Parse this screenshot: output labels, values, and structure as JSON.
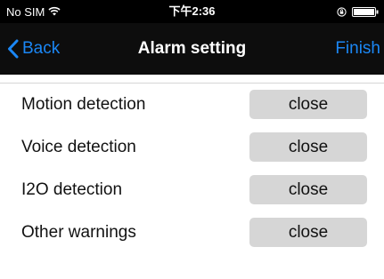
{
  "status_bar": {
    "carrier": "No SIM",
    "time": "下午2:36",
    "wifi_icon": "wifi-icon",
    "lock_icon": "rotation-lock-icon",
    "battery_icon": "battery-icon"
  },
  "nav": {
    "back_label": "Back",
    "title": "Alarm setting",
    "finish_label": "Finish"
  },
  "settings": [
    {
      "label": "Motion detection",
      "value": "close"
    },
    {
      "label": "Voice detection",
      "value": "close"
    },
    {
      "label": "I2O detection",
      "value": "close"
    },
    {
      "label": "Other warnings",
      "value": "close"
    }
  ],
  "colors": {
    "accent": "#1b87f5",
    "nav_background": "#0d0d0d",
    "status_background": "#000000",
    "button_background": "#d6d6d6"
  }
}
